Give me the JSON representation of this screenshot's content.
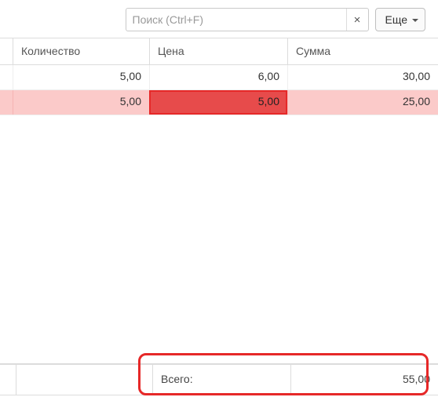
{
  "search": {
    "placeholder": "Поиск (Ctrl+F)",
    "value": "",
    "clear_symbol": "×"
  },
  "more_button_label": "Еще",
  "columns": {
    "qty": "Количество",
    "price": "Цена",
    "sum": "Сумма"
  },
  "rows": [
    {
      "qty": "5,00",
      "price": "6,00",
      "sum": "30,00",
      "highlight": false,
      "price_error": false
    },
    {
      "qty": "5,00",
      "price": "5,00",
      "sum": "25,00",
      "highlight": true,
      "price_error": true
    }
  ],
  "footer": {
    "label": "Всего:",
    "value": "55,00"
  }
}
